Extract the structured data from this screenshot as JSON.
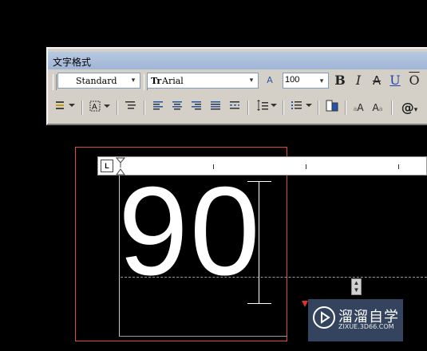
{
  "toolbar": {
    "title": "文字格式",
    "style_value": "Standard",
    "font_prefix": "Tr",
    "font_value": "Arial",
    "height_value": "100",
    "bold": "B",
    "italic": "I",
    "strike": "A",
    "underline": "U",
    "overline": "O",
    "text_color_glyph": "A",
    "at_symbol": "@",
    "superscript_label": "A",
    "subscript_label": "A"
  },
  "ruler": {
    "tab_marker": "L"
  },
  "editor": {
    "text": "90"
  },
  "watermark": {
    "title": "溜溜自学",
    "url": "ZIXUE.3D66.COM"
  },
  "icons": [
    "toolbar-grip-icon",
    "text-height-icon",
    "bold-icon",
    "italic-icon",
    "strikethrough-icon",
    "underline-icon",
    "overline-icon",
    "stack-icon",
    "justification-icon",
    "paragraph-icon",
    "align-left-icon",
    "align-center-icon",
    "align-right-icon",
    "justify-icon",
    "distribute-icon",
    "line-spacing-icon",
    "numbering-icon",
    "insert-field-icon",
    "uppercase-icon",
    "lowercase-icon",
    "symbol-icon",
    "play-icon"
  ],
  "colors": {
    "accent_red": "#e04848",
    "toolbar_bg": "#d4d0c8",
    "title_bar": "#a8bcd9"
  }
}
